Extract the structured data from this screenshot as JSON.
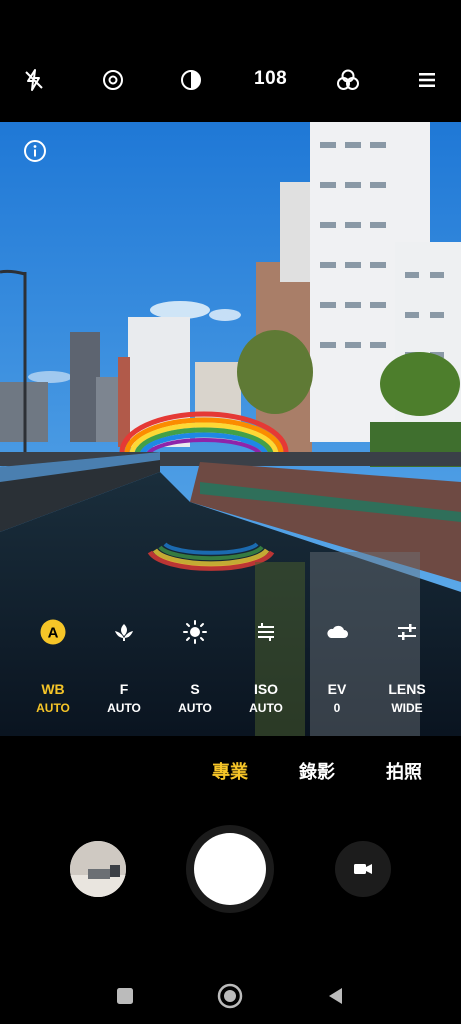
{
  "top_bar": {
    "flash_icon": "flash-off-icon",
    "lens_icon": "eye-ring-icon",
    "exposure_icon": "half-circle-icon",
    "resolution_label": "108",
    "filters_icon": "three-circles-icon",
    "menu_icon": "hamburger-menu-icon"
  },
  "info_icon": "info-circle-icon",
  "pro_controls": [
    {
      "icon": "auto-badge-icon",
      "title": "WB",
      "value": "AUTO",
      "active": true
    },
    {
      "icon": "focus-flower-icon",
      "title": "F",
      "value": "AUTO",
      "active": false
    },
    {
      "icon": "sun-icon",
      "title": "S",
      "value": "AUTO",
      "active": false
    },
    {
      "icon": "iso-lines-icon",
      "title": "ISO",
      "value": "AUTO",
      "active": false
    },
    {
      "icon": "cloud-icon",
      "title": "EV",
      "value": "0",
      "active": false
    },
    {
      "icon": "sliders-icon",
      "title": "LENS",
      "value": "WIDE",
      "active": false
    }
  ],
  "modes": [
    {
      "label": "專業",
      "active": true
    },
    {
      "label": "錄影",
      "active": false
    },
    {
      "label": "拍照",
      "active": false
    }
  ],
  "colors": {
    "accent": "#f6c528",
    "sky": "#2f8be3",
    "background": "#000000"
  },
  "bottom": {
    "gallery_icon": "gallery-thumbnail",
    "shutter_icon": "shutter-button",
    "video_icon": "video-camera-icon"
  },
  "nav": {
    "recents_icon": "square-icon",
    "home_icon": "circle-home-icon",
    "back_icon": "back-triangle-icon"
  }
}
